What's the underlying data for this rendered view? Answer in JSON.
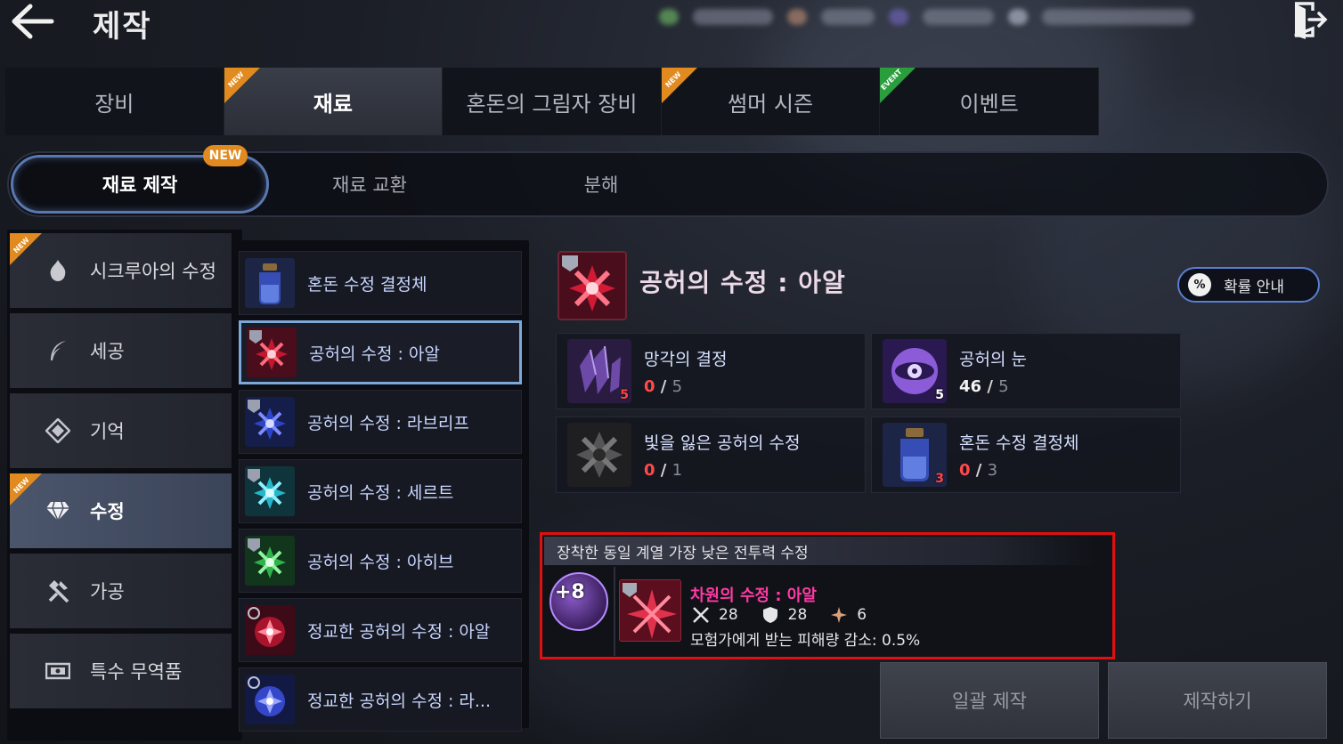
{
  "header": {
    "title": "제작"
  },
  "top_tabs": [
    {
      "label": "장비",
      "badge": ""
    },
    {
      "label": "재료",
      "badge": "NEW"
    },
    {
      "label": "혼돈의 그림자 장비",
      "badge": ""
    },
    {
      "label": "썸머 시즌",
      "badge": "NEW"
    },
    {
      "label": "이벤트",
      "badge": "EVENT"
    }
  ],
  "sub_tabs": [
    {
      "label": "재료 제작",
      "badge": "NEW"
    },
    {
      "label": "재료 교환"
    },
    {
      "label": "분해"
    }
  ],
  "categories": [
    {
      "label": "시크루아의 수정",
      "badge": "NEW",
      "icon": "flame-crystal-icon"
    },
    {
      "label": "세공",
      "badge": "",
      "icon": "feather-icon"
    },
    {
      "label": "기억",
      "badge": "",
      "icon": "memory-diamond-icon"
    },
    {
      "label": "수정",
      "badge": "NEW",
      "icon": "gem-icon"
    },
    {
      "label": "가공",
      "badge": "",
      "icon": "hammer-icon"
    },
    {
      "label": "특수 무역품",
      "badge": "",
      "icon": "trade-goods-icon"
    }
  ],
  "materials": [
    {
      "name": "혼돈 수정 결정체",
      "color": "#3b55c9"
    },
    {
      "name": "공허의 수정 : 아알",
      "color": "#c0182f"
    },
    {
      "name": "공허의 수정 : 라브리프",
      "color": "#2e44c8"
    },
    {
      "name": "공허의 수정 : 세르트",
      "color": "#23b7c9"
    },
    {
      "name": "공허의 수정 : 아히브",
      "color": "#2fb24a"
    },
    {
      "name": "정교한 공허의 수정 : 아알",
      "color": "#a8142c"
    },
    {
      "name": "정교한 공허의 수정 : 라...",
      "color": "#3447c9"
    }
  ],
  "detail": {
    "title": "공허의 수정 : 아알",
    "prob_button": "확률 안내",
    "prob_icon_text": "%",
    "ingredients": [
      {
        "name": "망각의 결정",
        "have": "0",
        "need": "5",
        "badge": "5",
        "color": "#6d4aa8"
      },
      {
        "name": "공허의 눈",
        "have": "46",
        "need": "5",
        "badge": "5",
        "color": "#8b5bd8"
      },
      {
        "name": "빛을 잃은 공허의 수정",
        "have": "0",
        "need": "1",
        "badge": "",
        "color": "#4a4a4a"
      },
      {
        "name": "혼돈 수정 결정체",
        "have": "0",
        "need": "3",
        "badge": "3",
        "color": "#3b55c9"
      }
    ]
  },
  "compare": {
    "header": "장착한 동일 계열 가장 낮은 전투력 수정",
    "level": "+8",
    "gem_name": "차원의 수정 : 아알",
    "stats": [
      {
        "icon": "sword-icon",
        "value": "28"
      },
      {
        "icon": "shield-icon",
        "value": "28"
      },
      {
        "icon": "spark-icon",
        "value": "6"
      }
    ],
    "effect": "모험가에게 받는 피해량 감소: 0.5%"
  },
  "buttons": {
    "batch": "일괄 제작",
    "craft": "제작하기"
  }
}
